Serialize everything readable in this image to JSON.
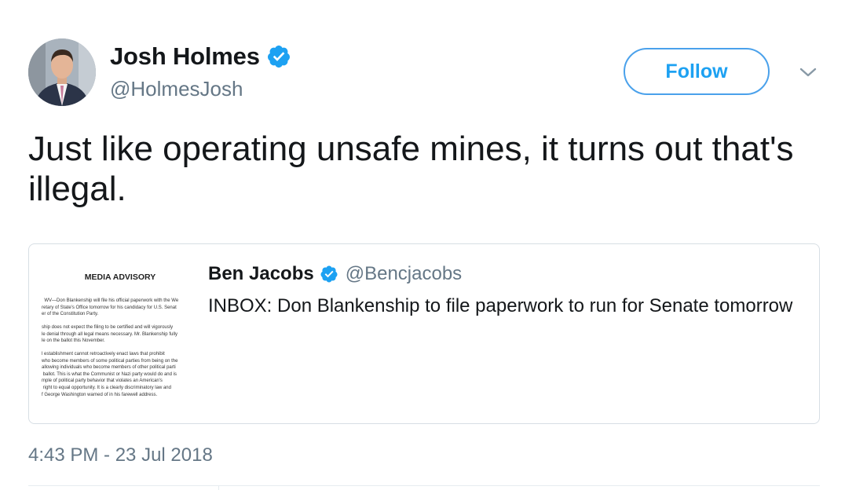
{
  "author": {
    "display_name": "Josh Holmes",
    "handle": "@HolmesJosh",
    "verified": true,
    "avatar_icon": "profile-photo"
  },
  "follow_button": {
    "label": "Follow"
  },
  "menu": {
    "icon": "chevron-down-icon"
  },
  "tweet": {
    "text": "Just like operating unsafe mines, it turns out that's illegal."
  },
  "quoted_tweet": {
    "display_name": "Ben Jacobs",
    "handle": "@Bencjacobs",
    "verified": true,
    "text": "INBOX: Don Blankenship to file paperwork to run for Senate tomorrow",
    "thumbnail": {
      "title": "MEDIA ADVISORY",
      "paragraphs": [
        "  WV—Don Blankenship will file his official paperwork with the We\nretary of State's Office tomorrow for his candidacy for U.S. Senat\ner of the Constitution Party.",
        "ship does not expect the filing to be certified and will vigorously\nle denial through all legal means necessary. Mr. Blankenship fully\nle on the ballot this November.",
        "l establishment cannot retroactively enact laws that prohibit\nwho become members of some political parties from being on the\nallowing individuals who become members of other political parti\n ballot. This is what the Communist or Nazi party would do and is\nmple of political party behavior that violates an American's\n right to equal opportunity. It is a clearly discriminatory law and\nf George Washington warned of in his farewell address."
      ]
    }
  },
  "timestamp": "4:43 PM - 23 Jul 2018",
  "colors": {
    "accent": "#1da1f2",
    "verified": "#1da1f2",
    "secondary_text": "#657786",
    "border": "#d7dee4"
  }
}
